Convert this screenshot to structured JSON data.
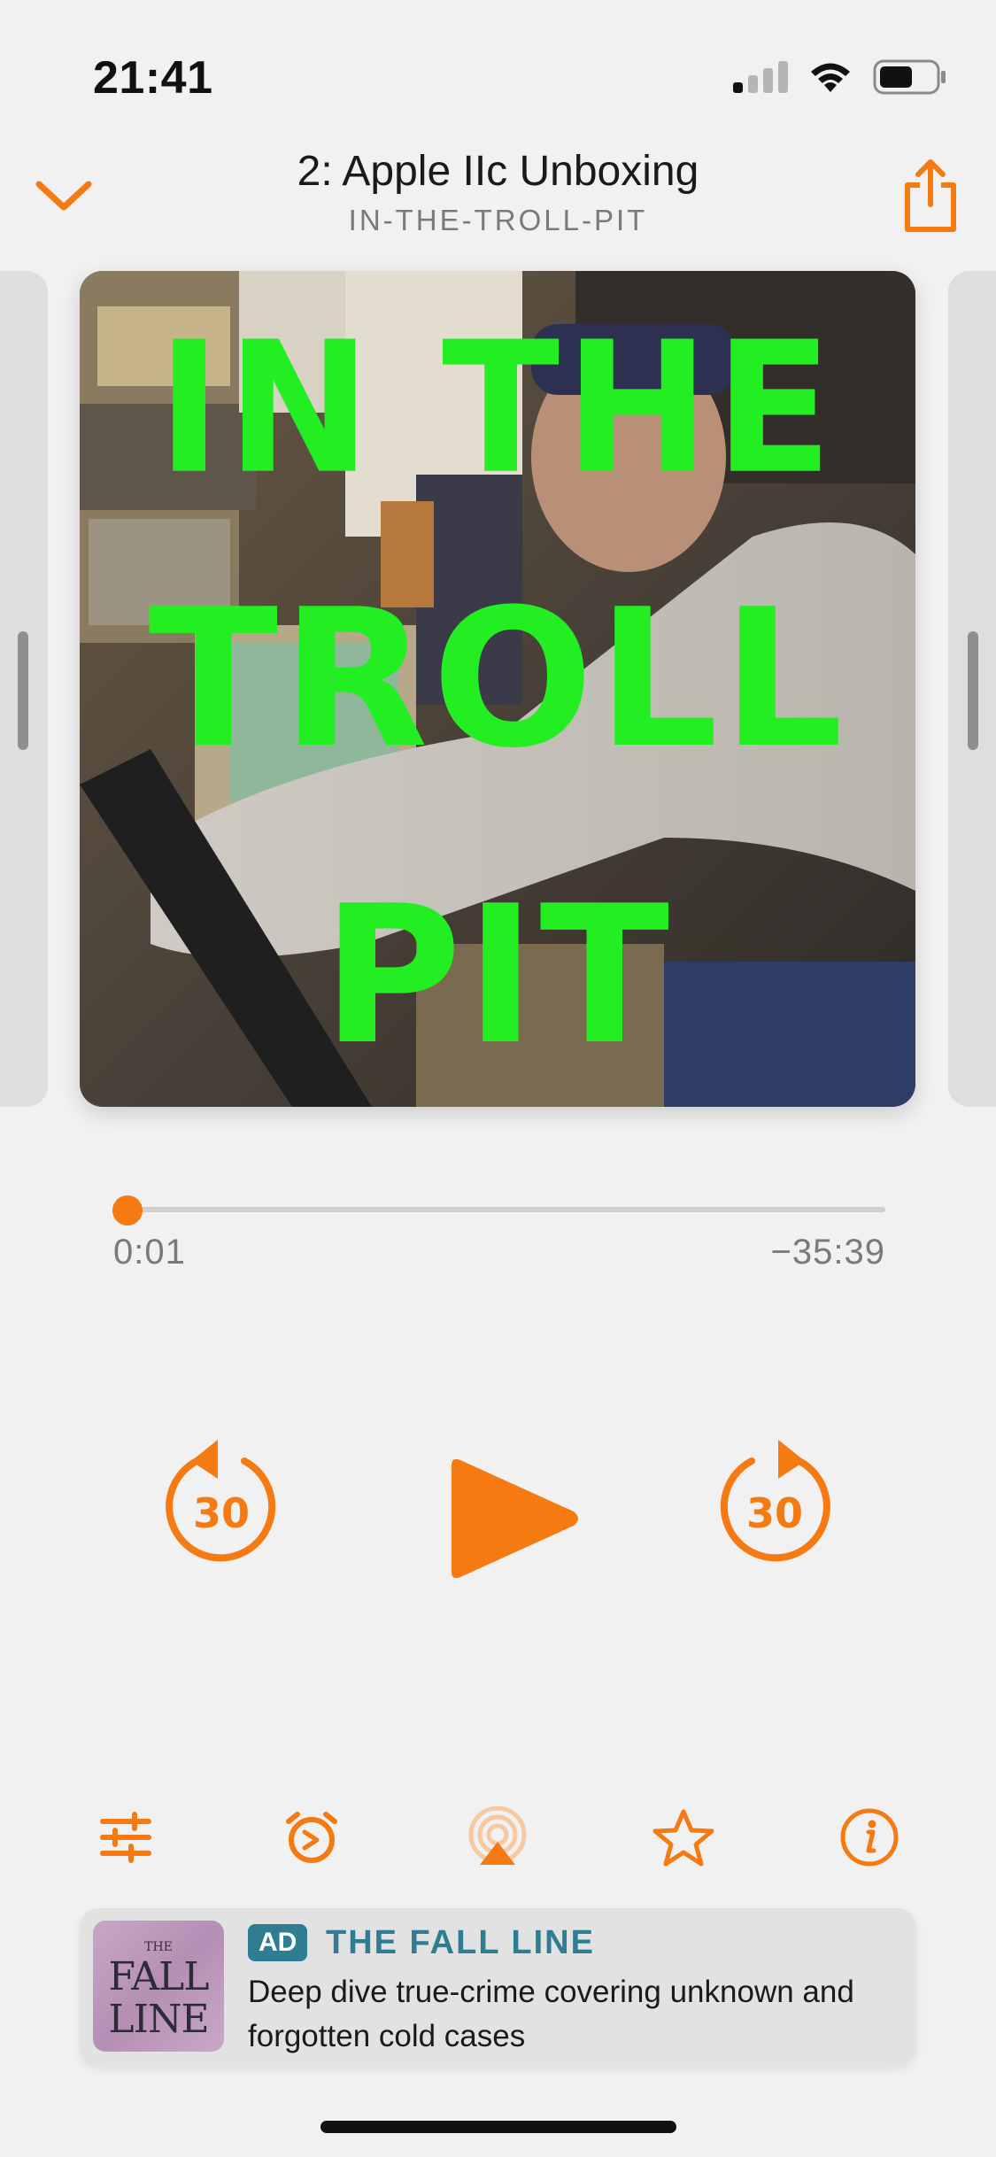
{
  "status_bar": {
    "time": "21:41"
  },
  "header": {
    "episode_title": "2: Apple IIc Unboxing",
    "podcast_name": "IN-THE-TROLL-PIT"
  },
  "artwork": {
    "overlay_lines": [
      "IN THE",
      "TROLL",
      "PIT"
    ]
  },
  "player": {
    "elapsed": "0:01",
    "remaining": "−35:39",
    "progress_fraction": 0.0005,
    "skip_back_seconds": "30",
    "skip_forward_seconds": "30"
  },
  "toolbar": {
    "items": [
      "sliders-icon",
      "alarm-clock-icon",
      "airplay-icon",
      "star-icon",
      "info-icon"
    ]
  },
  "ad": {
    "badge": "AD",
    "title": "THE FALL LINE",
    "description": "Deep dive true-crime covering unknown and forgotten cold cases",
    "thumb_the": "THE",
    "thumb_fall": "FALL",
    "thumb_line": "LINE"
  },
  "colors": {
    "accent": "#f47a11",
    "ad_accent": "#2f7d93",
    "artwork_text": "#22ee22"
  }
}
